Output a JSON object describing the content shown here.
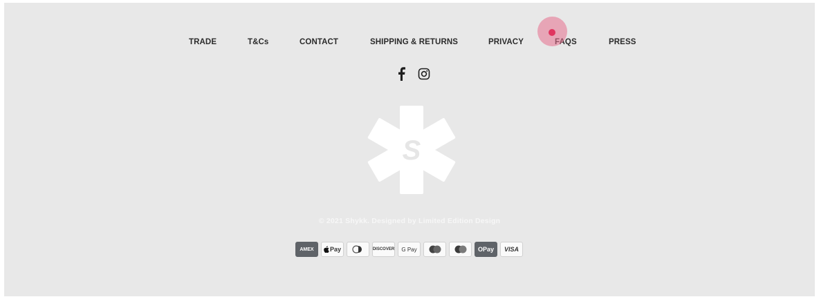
{
  "nav": {
    "items": [
      {
        "label": "TRADE"
      },
      {
        "label": "T&Cs"
      },
      {
        "label": "CONTACT"
      },
      {
        "label": "SHIPPING & RETURNS"
      },
      {
        "label": "PRIVACY"
      },
      {
        "label": "FAQS"
      },
      {
        "label": "PRESS"
      }
    ]
  },
  "social": {
    "facebook_icon": "facebook-icon",
    "instagram_icon": "instagram-icon"
  },
  "logo": {
    "letter": "S"
  },
  "copyright": "© 2021 Shykk. Designed by Limited Edition Design",
  "payments": [
    {
      "name": "AMEX",
      "style": "amex"
    },
    {
      "name": "Pay",
      "style": "applepay"
    },
    {
      "name": "",
      "style": "diners"
    },
    {
      "name": "DISCOVER",
      "style": "discover"
    },
    {
      "name": "G Pay",
      "style": "gpay"
    },
    {
      "name": "",
      "style": "maestro"
    },
    {
      "name": "",
      "style": "mastercard"
    },
    {
      "name": "OPay",
      "style": "opay"
    },
    {
      "name": "VISA",
      "style": "visa"
    }
  ],
  "colors": {
    "background": "#e8e8e8",
    "nav_text": "#2b2b2b",
    "logo": "#ffffff",
    "cursor": "#e0355f"
  }
}
